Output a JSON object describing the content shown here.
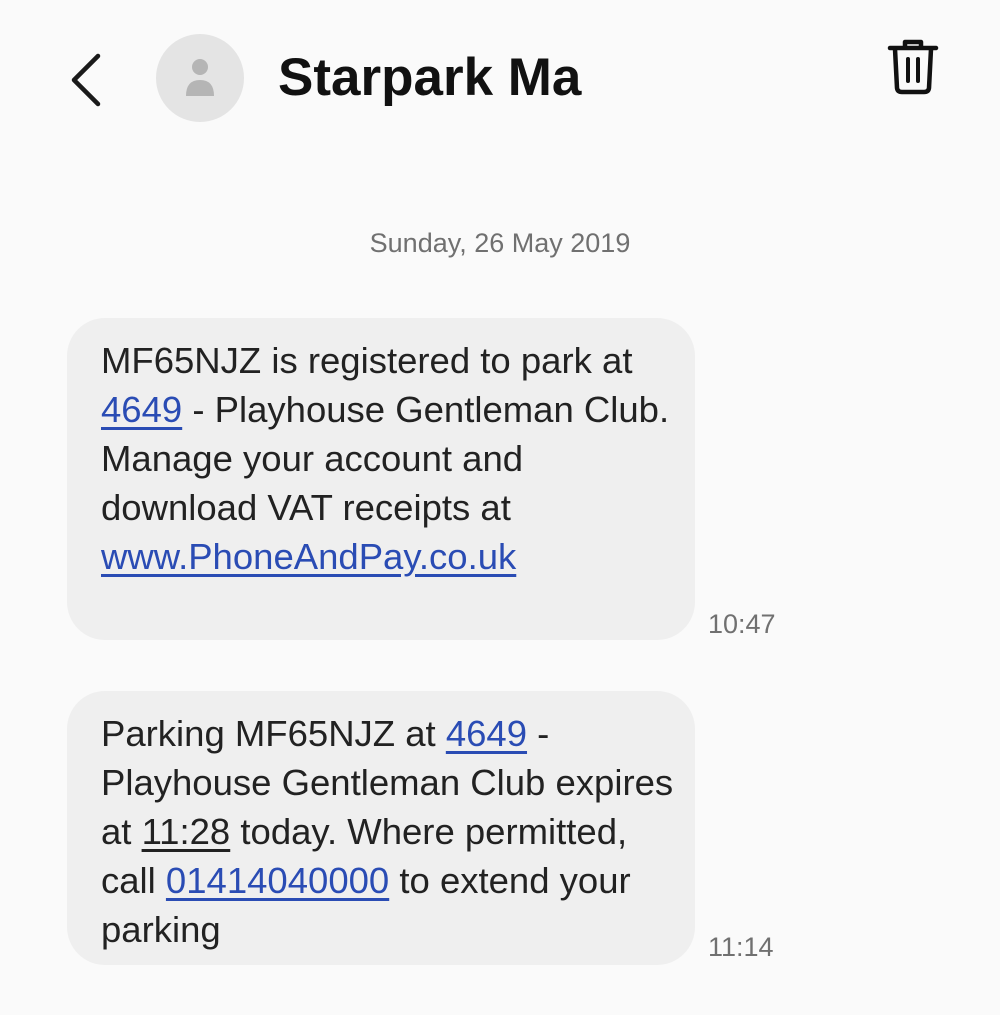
{
  "header": {
    "contact_name": "Starpark Ma",
    "icons": {
      "back": "chevron-left-icon",
      "avatar": "person-icon",
      "delete": "trash-icon"
    }
  },
  "conversation": {
    "date_separator": "Sunday, 26 May 2019",
    "messages": [
      {
        "time": "10:47",
        "parts": {
          "t1": "MF65NJZ is registered to park at ",
          "link1": "4649",
          "t2": " - Playhouse Gentleman Club. Manage your account and download VAT receipts at ",
          "link2": "www.PhoneAndPay.co.uk"
        }
      },
      {
        "time": "11:14",
        "parts": {
          "t1": "Parking MF65NJZ at ",
          "link1": "4649",
          "t2": " - Playhouse Gentleman Club expires at ",
          "time_link": "11:28",
          "t3": " today. Where permitted, call ",
          "phone_link": "01414040000",
          "t4": " to extend your parking"
        }
      }
    ]
  },
  "colors": {
    "background": "#fafafa",
    "bubble": "#efefef",
    "link": "#2a4cb4",
    "secondary_text": "#707070"
  }
}
